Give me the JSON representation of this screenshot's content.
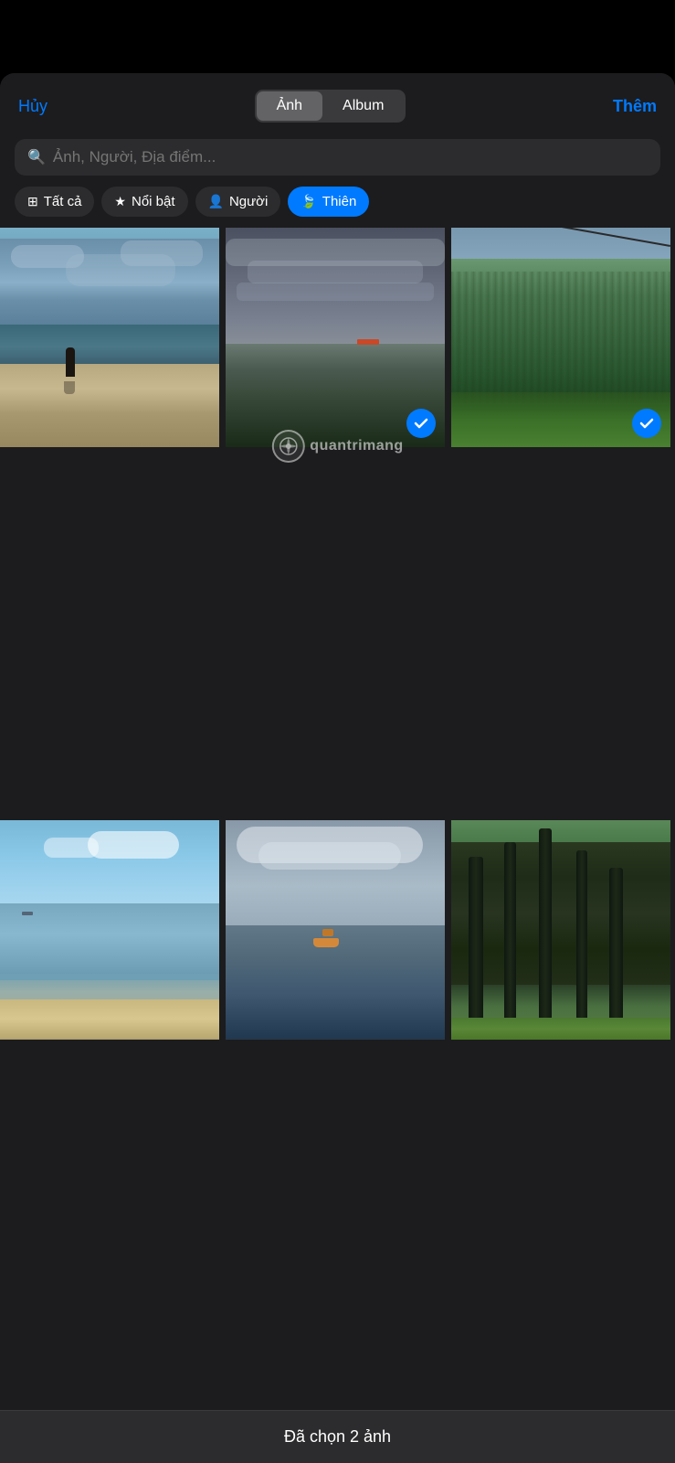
{
  "header": {
    "cancel_label": "Hủy",
    "add_label": "Thêm",
    "segments": [
      {
        "label": "Ảnh",
        "active": true
      },
      {
        "label": "Album",
        "active": false
      }
    ]
  },
  "search": {
    "placeholder": "Ảnh, Người, Địa điểm..."
  },
  "filter_tabs": [
    {
      "id": "all",
      "label": "Tất cả",
      "icon": "grid",
      "active": false
    },
    {
      "id": "featured",
      "label": "Nổi bật",
      "icon": "star",
      "active": false
    },
    {
      "id": "people",
      "label": "Người",
      "icon": "person",
      "active": false
    },
    {
      "id": "nature",
      "label": "Thiên",
      "icon": "leaf",
      "active": true
    }
  ],
  "watermark": {
    "text": "quantrimang"
  },
  "photos": [
    {
      "id": 1,
      "selected": false,
      "description": "beach with person standing"
    },
    {
      "id": 2,
      "selected": true,
      "description": "seascape cloudy"
    },
    {
      "id": 3,
      "selected": true,
      "description": "green mountains cable"
    },
    {
      "id": 4,
      "selected": false,
      "description": "blue beach ocean"
    },
    {
      "id": 5,
      "selected": false,
      "description": "ocean with boat"
    },
    {
      "id": 6,
      "selected": false,
      "description": "pine forest trees"
    }
  ],
  "bottom_bar": {
    "selected_count": "Đã chọn 2 ảnh"
  }
}
